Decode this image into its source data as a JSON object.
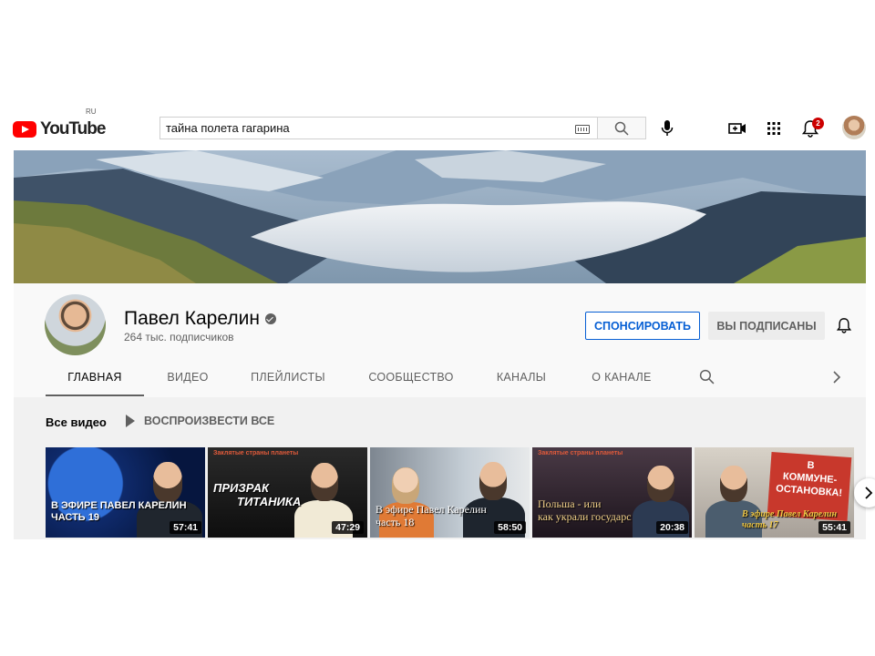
{
  "topbar": {
    "logo_text": "YouTube",
    "logo_country": "RU",
    "search_value": "тайна полета гагарина",
    "notification_count": "2"
  },
  "channel": {
    "name": "Павел Карелин",
    "subscribers": "264 тыс. подписчиков",
    "sponsor_label": "СПОНСИРОВАТЬ",
    "subscribed_label": "ВЫ ПОДПИСАНЫ",
    "tabs": [
      {
        "label": "ГЛАВНАЯ",
        "active": true
      },
      {
        "label": "ВИДЕО"
      },
      {
        "label": "ПЛЕЙЛИСТЫ"
      },
      {
        "label": "СООБЩЕСТВО"
      },
      {
        "label": "КАНАЛЫ"
      },
      {
        "label": "О КАНАЛЕ"
      }
    ]
  },
  "section": {
    "title": "Все видео",
    "play_all": "ВОСПРОИЗВЕСТИ ВСЕ"
  },
  "videos": [
    {
      "overlay_line1": "В ЭФИРЕ ПАВЕЛ КАРЕЛИН",
      "overlay_line2": "ЧАСТЬ 19",
      "duration": "57:41",
      "bg": "#0f2a6b"
    },
    {
      "overlay_label": "Заклятые страны планеты",
      "overlay_line1": "ПРИЗРАК",
      "overlay_line2": "ТИТАНИКА",
      "duration": "47:29",
      "bg": "#1a1a1a"
    },
    {
      "overlay_line1": "В эфире Павел Карелин",
      "overlay_line2": "часть 18",
      "duration": "58:50",
      "bg": "#6f7a85"
    },
    {
      "overlay_label": "Заклятые страны планеты",
      "overlay_line1": "Польша - или",
      "overlay_line2": "как украли государс",
      "duration": "20:38",
      "bg": "#2a2230"
    },
    {
      "overlay_line1": "В эфире Павел Карелин",
      "overlay_line2": "часть 17",
      "duration": "55:41",
      "bg": "#b9b2a8",
      "banner_line1": "В",
      "banner_line2": "КОММУНЕ-",
      "banner_line3": "ОСТАНОВКА!"
    }
  ],
  "colors": {
    "brand_red": "#ff0000",
    "link_blue": "#065fd4",
    "badge_red": "#cc0000"
  }
}
